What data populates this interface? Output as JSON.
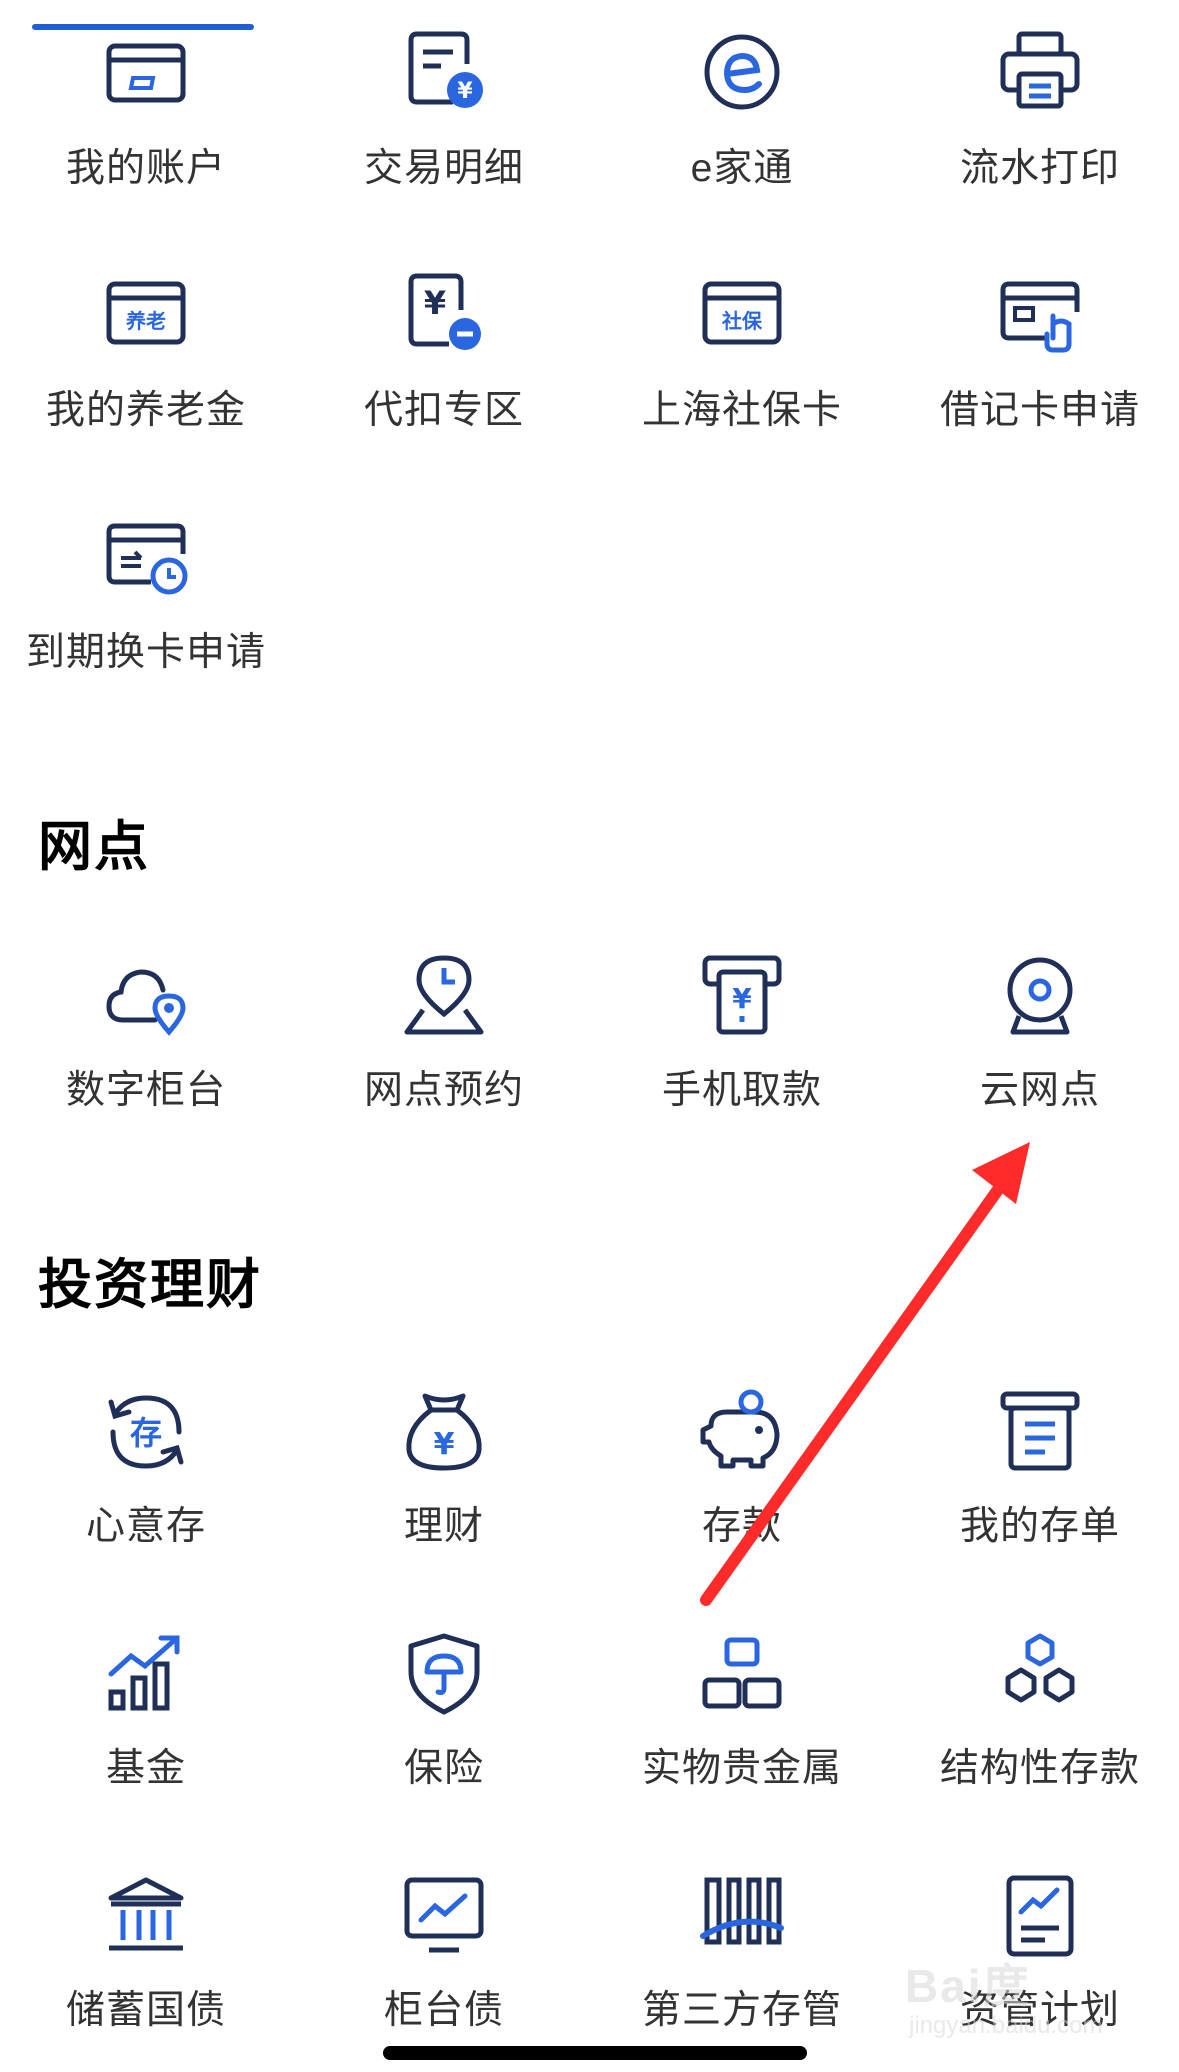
{
  "account_section": {
    "items": [
      {
        "label": "我的账户",
        "icon": "bank-card-icon"
      },
      {
        "label": "交易明细",
        "icon": "transaction-detail-icon"
      },
      {
        "label": "e家通",
        "icon": "e-logo-icon"
      },
      {
        "label": "流水打印",
        "icon": "printer-icon"
      },
      {
        "label": "我的养老金",
        "icon": "pension-card-icon",
        "badge": "养老"
      },
      {
        "label": "代扣专区",
        "icon": "withhold-icon"
      },
      {
        "label": "上海社保卡",
        "icon": "social-security-card-icon",
        "badge": "社保"
      },
      {
        "label": "借记卡申请",
        "icon": "debit-card-apply-icon"
      },
      {
        "label": "到期换卡申请",
        "icon": "card-renewal-icon"
      }
    ]
  },
  "branch_section": {
    "title": "网点",
    "items": [
      {
        "label": "数字柜台",
        "icon": "cloud-location-icon"
      },
      {
        "label": "网点预约",
        "icon": "appointment-pin-icon"
      },
      {
        "label": "手机取款",
        "icon": "atm-withdraw-icon"
      },
      {
        "label": "云网点",
        "icon": "webcam-icon"
      }
    ]
  },
  "invest_section": {
    "title": "投资理财",
    "items": [
      {
        "label": "心意存",
        "icon": "deposit-cycle-icon",
        "badge": "存"
      },
      {
        "label": "理财",
        "icon": "money-bag-icon"
      },
      {
        "label": "存款",
        "icon": "piggy-bank-icon"
      },
      {
        "label": "我的存单",
        "icon": "certificate-icon"
      },
      {
        "label": "基金",
        "icon": "growth-bars-icon"
      },
      {
        "label": "保险",
        "icon": "shield-umbrella-icon"
      },
      {
        "label": "实物贵金属",
        "icon": "gold-bars-icon"
      },
      {
        "label": "结构性存款",
        "icon": "hexagons-icon"
      },
      {
        "label": "储蓄国债",
        "icon": "bank-building-icon"
      },
      {
        "label": "柜台债",
        "icon": "monitor-chart-icon"
      },
      {
        "label": "第三方存管",
        "icon": "custody-bars-icon"
      },
      {
        "label": "资管计划",
        "icon": "report-chart-icon"
      }
    ]
  },
  "colors": {
    "accent": "#2a66e0",
    "icon_dark": "#1f2f57",
    "annotation_arrow": "#ff2b2b"
  },
  "watermark": {
    "logo": "Bai度",
    "url": "jingyan.baidu.com"
  }
}
